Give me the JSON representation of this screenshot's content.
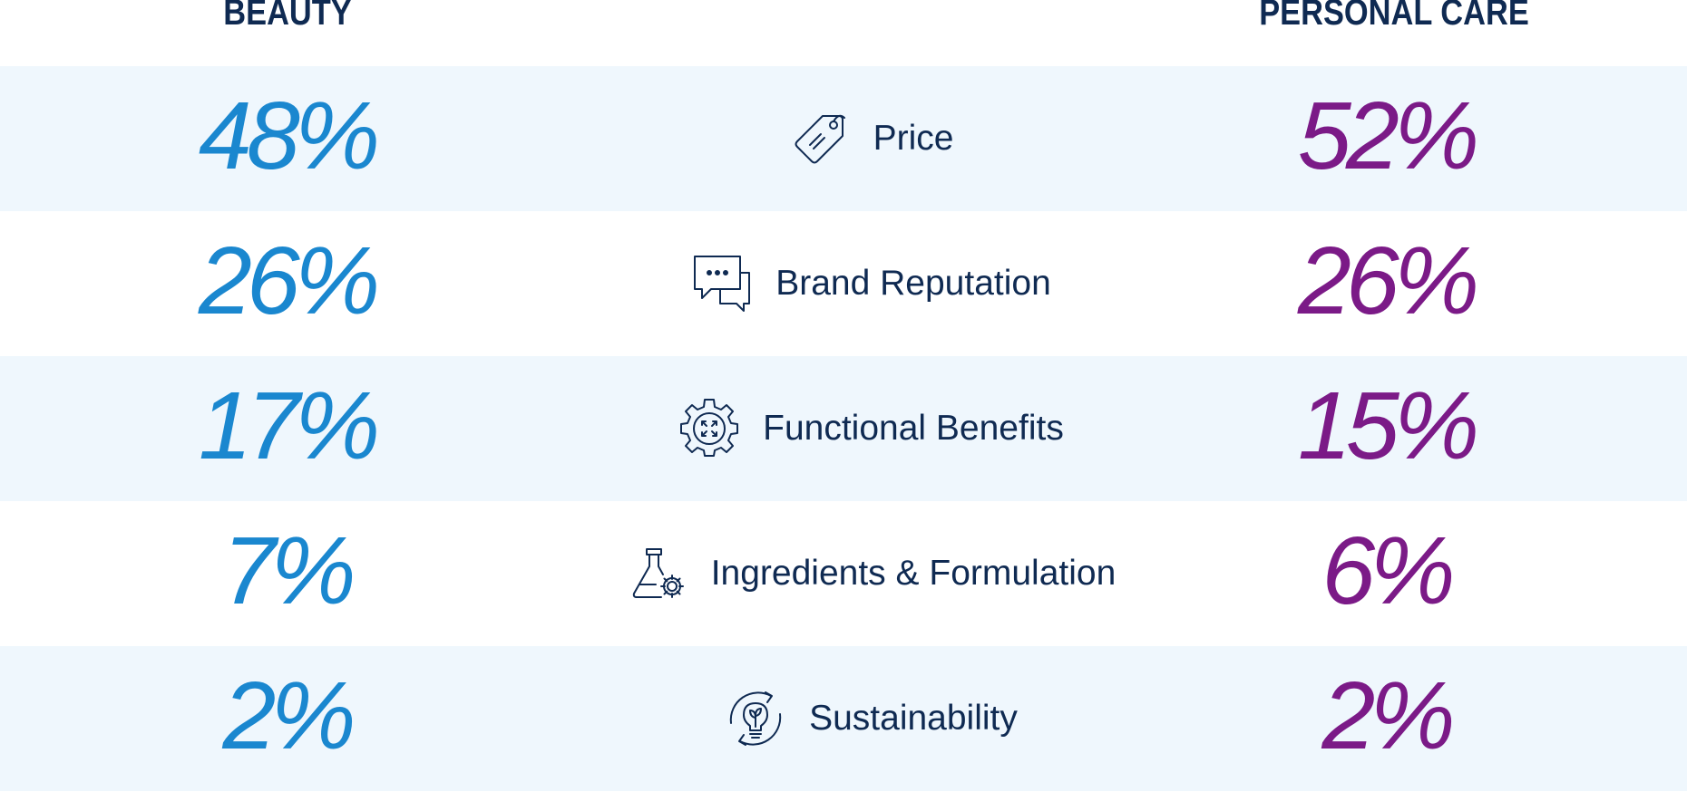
{
  "headers": {
    "beauty": "BEAUTY",
    "personal_care": "PERSONAL CARE"
  },
  "colors": {
    "beauty": "#1a87cf",
    "personal_care": "#7b1a87",
    "label": "#0f2a52",
    "row_shade": "#eff7fd"
  },
  "rows": [
    {
      "factor": "Price",
      "icon": "price-tag-icon",
      "beauty": "48%",
      "personal_care": "52%"
    },
    {
      "factor": "Brand Reputation",
      "icon": "chat-bubbles-icon",
      "beauty": "26%",
      "personal_care": "26%"
    },
    {
      "factor": "Functional Benefits",
      "icon": "gear-arrows-icon",
      "beauty": "17%",
      "personal_care": "15%"
    },
    {
      "factor": "Ingredients & Formulation",
      "icon": "flask-gear-icon",
      "beauty": "7%",
      "personal_care": "6%"
    },
    {
      "factor": "Sustainability",
      "icon": "lightbulb-leaf-cycle-icon",
      "beauty": "2%",
      "personal_care": "2%"
    }
  ],
  "chart_data": {
    "type": "table",
    "columns": [
      "BEAUTY",
      "",
      "PERSONAL CARE"
    ],
    "categories": [
      "Price",
      "Brand Reputation",
      "Functional Benefits",
      "Ingredients & Formulation",
      "Sustainability"
    ],
    "series": [
      {
        "name": "BEAUTY",
        "values": [
          48,
          26,
          17,
          7,
          2
        ]
      },
      {
        "name": "PERSONAL CARE",
        "values": [
          52,
          26,
          15,
          6,
          2
        ]
      }
    ]
  }
}
